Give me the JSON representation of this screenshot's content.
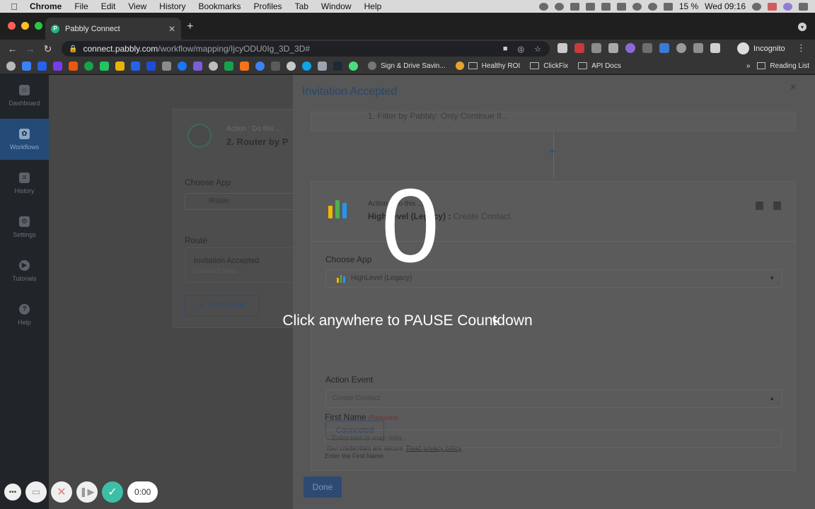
{
  "menubar": {
    "app": "Chrome",
    "items": [
      "File",
      "Edit",
      "View",
      "History",
      "Bookmarks",
      "Profiles",
      "Tab",
      "Window",
      "Help"
    ],
    "battery": "15 %",
    "clock": "Wed 09:16"
  },
  "browser": {
    "tab_title": "Pabbly Connect",
    "url_host": "connect.pabbly.com",
    "url_path": "/workflow/mapping/IjcyODU0Ig_3D_3D#",
    "profile": "Incognito",
    "bookmarks": [
      "Sign & Drive Savin...",
      "Healthy ROI",
      "ClickFix",
      "API Docs"
    ],
    "reading_list": "Reading List",
    "more": "»"
  },
  "sidebar": {
    "items": [
      {
        "label": "Dashboard"
      },
      {
        "label": "Workflows"
      },
      {
        "label": "History"
      },
      {
        "label": "Settings"
      },
      {
        "label": "Tutorials"
      },
      {
        "label": "Help"
      }
    ]
  },
  "router_card": {
    "subtitle": "Action : Do this ...",
    "title": "2. Router by P",
    "choose_app_label": "Choose App",
    "choose_app_value": "Router",
    "route_label": "Route",
    "route_name": "Invitation Accepted",
    "route_steps": "Contains 2 Steps",
    "add_route": "Add Route"
  },
  "drawer": {
    "title": "Invitation Accepted",
    "close": "×",
    "prev_step": "1. Filter by Pabbly: Only Continue If...",
    "plus": "+",
    "action": {
      "subtitle": "Action : Do this ...",
      "app_name": "HighLevel (Legacy) :",
      "event": "Create Contact",
      "choose_app_label": "Choose App",
      "choose_app_value": "HighLevel (Legacy)",
      "action_event_label": "Action Event",
      "action_event_value": "Create Contact",
      "connected": "Connected",
      "secure_note": "Your credentials are secure.",
      "privacy_link": "Read privacy policy",
      "first_name_label": "First Name",
      "required": "(Required)",
      "first_name_placeholder": "Enter text or map data..",
      "first_name_help": "Enter the First Name."
    },
    "done": "Done"
  },
  "countdown": {
    "number": "0",
    "hint": "Click anywhere to PAUSE Countdown"
  },
  "recorder": {
    "time": "0:00"
  }
}
